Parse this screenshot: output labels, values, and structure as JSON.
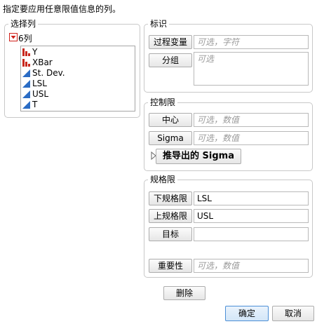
{
  "instruction": "指定要应用任意限值信息的列。",
  "select_columns": {
    "title": "选择列",
    "count_label": "6列",
    "columns": [
      {
        "name": "Y",
        "type": "nominal-icon"
      },
      {
        "name": "XBar",
        "type": "nominal-icon"
      },
      {
        "name": "St. Dev.",
        "type": "continuous-icon"
      },
      {
        "name": "LSL",
        "type": "continuous-icon"
      },
      {
        "name": "USL",
        "type": "continuous-icon"
      },
      {
        "name": "T",
        "type": "continuous-icon"
      }
    ]
  },
  "identify": {
    "title": "标识",
    "process_var_label": "过程变量",
    "process_var_placeholder": "可选，字符",
    "group_label": "分组",
    "group_placeholder": "可选"
  },
  "control_limits": {
    "title": "控制限",
    "center_label": "中心",
    "center_placeholder": "可选，数值",
    "sigma_label": "Sigma",
    "sigma_placeholder": "可选，数值",
    "derived_sigma_label": "推导出的 Sigma"
  },
  "spec_limits": {
    "title": "规格限",
    "lsl_label": "下规格限",
    "lsl_value": "LSL",
    "usl_label": "上规格限",
    "usl_value": "USL",
    "target_label": "目标",
    "target_value": "",
    "importance_label": "重要性",
    "importance_placeholder": "可选，数值"
  },
  "actions": {
    "remove_label": "删除",
    "ok_label": "确定",
    "cancel_label": "取消"
  },
  "colors": {
    "nominal_icon": "#c8281e",
    "continuous_icon": "#2b6cc4",
    "toggle_red": "#d0201a",
    "primary_border": "#4c8fd6"
  }
}
